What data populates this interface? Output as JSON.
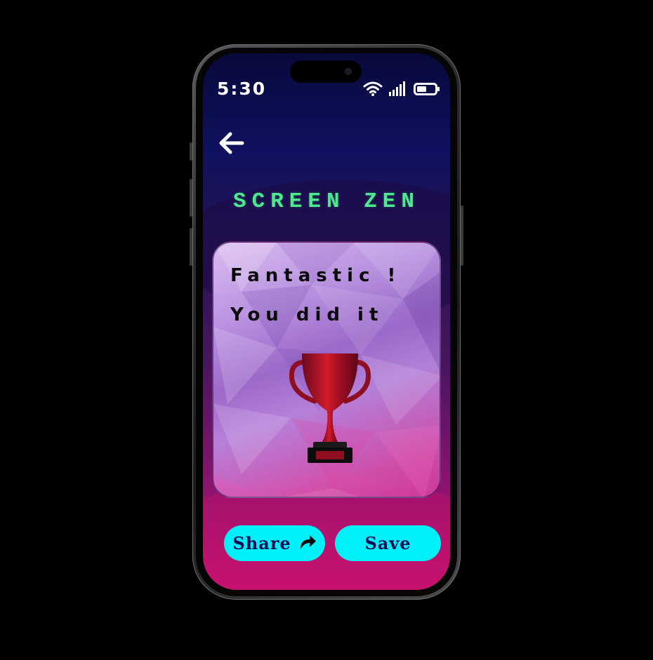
{
  "status_bar": {
    "time": "5:30",
    "icons": [
      "wifi-icon",
      "cellular-signal-icon",
      "battery-icon"
    ]
  },
  "header": {
    "back_icon": "arrow-left-icon",
    "app_title": "SCREEN ZEN"
  },
  "card": {
    "line1": "Fantastic !",
    "line2": "You did it",
    "image": "trophy"
  },
  "actions": {
    "share_label": "Share",
    "share_icon": "share-arrow-icon",
    "save_label": "Save"
  },
  "colors": {
    "accent_button": "#00f0f8",
    "button_text": "#0d0d55",
    "title_green": "#4ee88f",
    "background_top": "#08093a",
    "background_bottom": "#c7106f"
  }
}
